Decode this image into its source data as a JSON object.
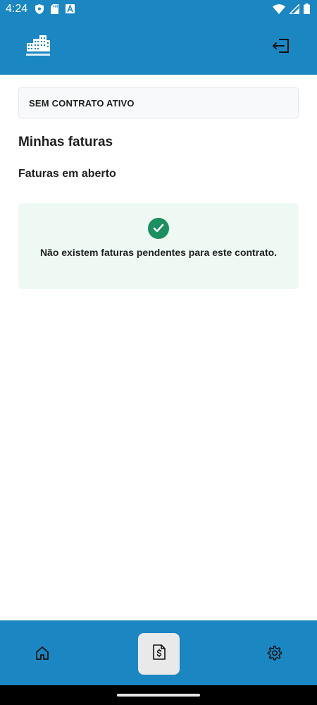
{
  "status_bar": {
    "time": "4:24",
    "left_icons": [
      "shield-icon",
      "sd-card-icon",
      "font-icon"
    ],
    "right_icons": [
      "wifi-icon",
      "signal-icon",
      "battery-icon"
    ]
  },
  "header": {
    "logo_icon": "building-logo-icon",
    "logout_icon": "logout-icon"
  },
  "contract": {
    "label": "SEM CONTRATO ATIVO"
  },
  "main": {
    "title": "Minhas faturas",
    "section_title": "Faturas em aberto",
    "empty_message": "Não existem faturas pendentes para este contrato.",
    "empty_icon": "check-circle-icon"
  },
  "bottom_nav": {
    "items": [
      {
        "icon": "home-icon",
        "active": false
      },
      {
        "icon": "invoice-dollar-icon",
        "active": true
      },
      {
        "icon": "gear-icon",
        "active": false
      }
    ]
  },
  "colors": {
    "primary": "#1a86c2",
    "success": "#1a8f5f",
    "success_bg": "#eef9f4",
    "active_nav_bg": "#e9e9ea"
  }
}
